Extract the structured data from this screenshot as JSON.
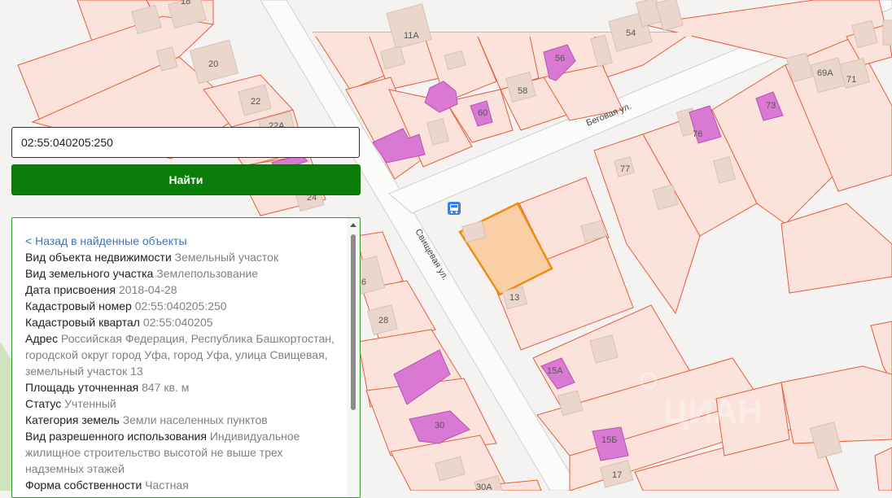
{
  "search": {
    "value": "02:55:040205:250"
  },
  "find_button": {
    "label": "Найти"
  },
  "info": {
    "back_link": "< Назад в найденные объекты",
    "rows": [
      {
        "k": "Вид объекта недвижимости",
        "v": "Земельный участок"
      },
      {
        "k": "Вид земельного участка",
        "v": "Землепользование"
      },
      {
        "k": "Дата присвоения",
        "v": "2018-04-28"
      },
      {
        "k": "Кадастровый номер",
        "v": "02:55:040205:250"
      },
      {
        "k": "Кадастровый квартал",
        "v": "02:55:040205"
      },
      {
        "k": "Адрес",
        "v": "Российская Федерация, Республика Башкортостан, городской округ город Уфа, город Уфа, улица Свищевая, земельный участок 13"
      },
      {
        "k": "Площадь уточненная",
        "v": "847 кв. м"
      },
      {
        "k": "Статус",
        "v": "Учтенный"
      },
      {
        "k": "Категория земель",
        "v": "Земли населенных пунктов"
      },
      {
        "k": "Вид разрешенного использования",
        "v": "Индивидуальное жилищное строительство высотой не выше трех надземных этажей"
      },
      {
        "k": "Форма собственности",
        "v": "Частная"
      }
    ]
  },
  "map": {
    "streets": [
      "Беговая ул.",
      "Свищевая ул."
    ],
    "house_numbers": [
      "18",
      "20",
      "22",
      "22А",
      "24",
      "11А",
      "54",
      "56",
      "58",
      "60",
      "69А",
      "71",
      "73",
      "76",
      "77",
      "6",
      "13",
      "28",
      "15А",
      "30",
      "15Б",
      "17",
      "30А"
    ],
    "bus_stop_icon": "bus-stop-icon",
    "watermark": "ЦИАН"
  },
  "colors": {
    "parcel_fill": "#fbe3dc",
    "parcel_border": "#e85c3a",
    "selected_fill": "#fbcfa6",
    "selected_border": "#f08c10",
    "building": "#ead6cb",
    "building_residential": "#d979d3",
    "button": "#0a7d0a",
    "panel_border": "#2e9a2e"
  }
}
